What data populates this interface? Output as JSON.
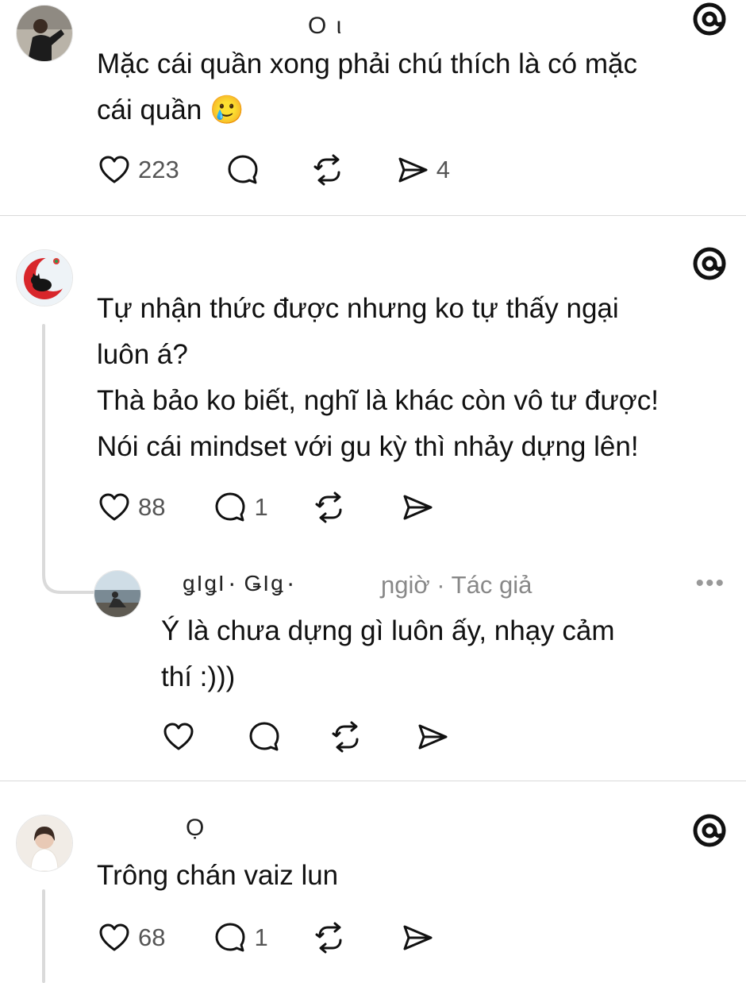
{
  "posts": [
    {
      "username_glyphs": "O ι",
      "text_lines": [
        "Mặc cái quần xong phải chú thích là có mặc",
        "cái quần 🥲"
      ],
      "likes": "223",
      "replies": "",
      "shares": "4"
    },
    {
      "username_glyphs": "",
      "text_lines": [
        "Tự nhận thức được nhưng ko tự thấy ngại",
        "luôn á?",
        "Thà bảo ko biết, nghĩ là khác còn vô tư được!",
        "Nói cái mindset với gu kỳ thì nhảy dựng lên!"
      ],
      "likes": "88",
      "replies": "1",
      "shares": "",
      "reply": {
        "name_glyphs": "ǥΙǥΙ٠   ǤΙǥ٠",
        "time_author": "ɲgiờ · Tác giả",
        "text_lines": [
          "Ý là chưa dựng gì luôn ấy, nhạy cảm",
          "thí :)))"
        ],
        "more": "•••"
      }
    },
    {
      "username_glyphs": "Ọ",
      "text_lines": [
        "Trông chán vaiz lun"
      ],
      "likes": "68",
      "replies": "1",
      "shares": ""
    }
  ],
  "icons": [
    "heart-icon",
    "comment-icon",
    "repost-icon",
    "share-icon",
    "threads-logo-icon"
  ],
  "colors": {
    "divider": "#d9d9d9",
    "count_text": "#555555",
    "meta_text": "#888888"
  }
}
